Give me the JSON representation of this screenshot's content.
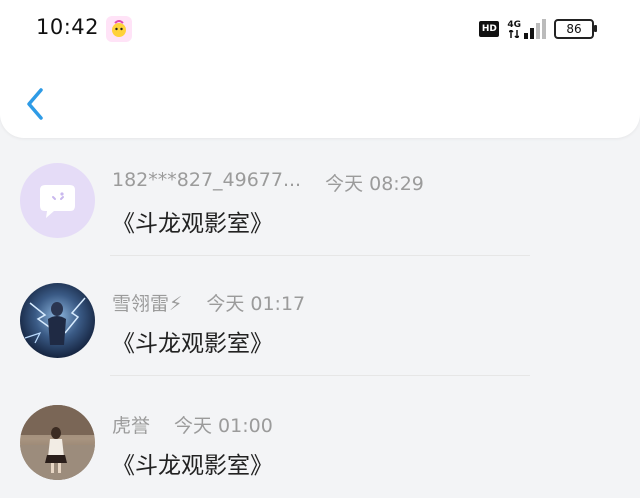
{
  "status_bar": {
    "time": "10:42",
    "hd": "HD",
    "network": "4G",
    "battery": "86"
  },
  "header": {
    "back_icon": "chevron-left-icon",
    "accent": "#2e9be6"
  },
  "messages": [
    {
      "name": "182***827_49677...",
      "time": "今天 08:29",
      "text": "《斗龙观影室》"
    },
    {
      "name": "雪翎雷⚡",
      "time": "今天 01:17",
      "text": "《斗龙观影室》"
    },
    {
      "name": "虎誉",
      "time": "今天 01:00",
      "text": "《斗龙观影室》"
    }
  ]
}
